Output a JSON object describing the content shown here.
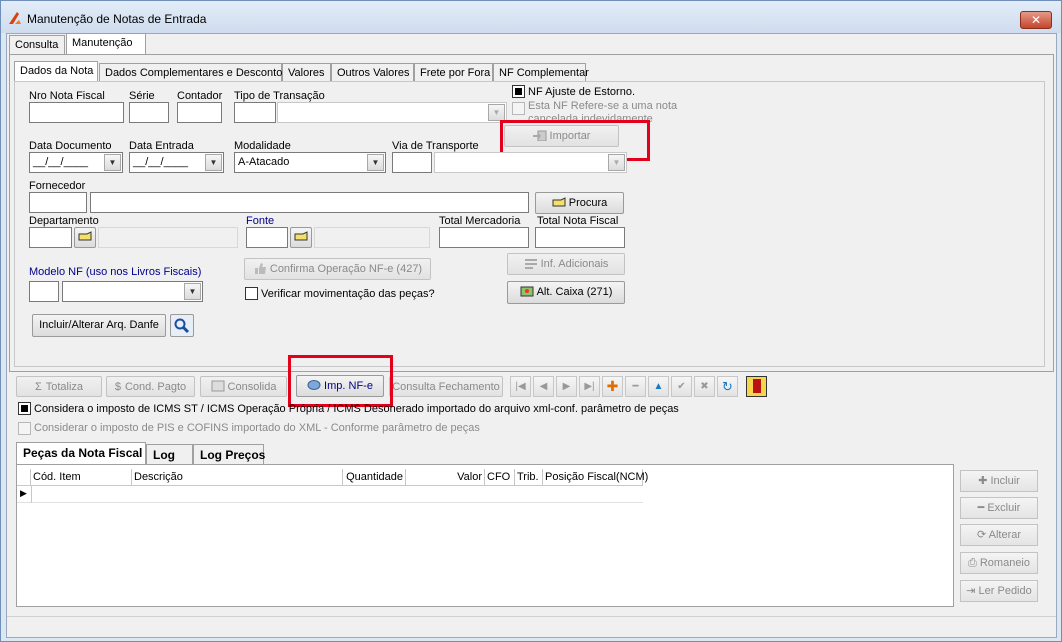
{
  "window": {
    "title": "Manutenção de Notas de Entrada",
    "close_label": "✕"
  },
  "main_tabs": [
    "Consulta",
    "Manutenção"
  ],
  "sub_tabs": [
    "Dados da Nota",
    "Dados Complementares e Desconto",
    "Valores",
    "Outros Valores",
    "Frete por Fora",
    "NF Complementar"
  ],
  "form": {
    "nro_nota_label": "Nro Nota Fiscal",
    "serie_label": "Série",
    "contador_label": "Contador",
    "tipo_transacao_label": "Tipo de Transação",
    "nf_ajuste_label": "NF Ajuste  de Estorno.",
    "nf_refere_label": "Esta NF Refere-se a uma nota cancelada indevidamente",
    "importar_label": "Importar",
    "data_documento_label": "Data Documento",
    "data_documento_value": "__/__/____",
    "data_entrada_label": "Data Entrada",
    "data_entrada_value": "__/__/____",
    "modalidade_label": "Modalidade",
    "modalidade_value": "A-Atacado",
    "via_transporte_label": "Via de Transporte",
    "fornecedor_label": "Fornecedor",
    "procura_label": "Procura",
    "departamento_label": "Departamento",
    "fonte_label": "Fonte",
    "total_mercadoria_label": "Total Mercadoria",
    "total_nota_label": "Total Nota Fiscal",
    "modelo_nf_label": "Modelo NF (uso nos Livros Fiscais)",
    "confirma_operacao_label": "Confirma Operação NF-e (427)",
    "inf_adicionais_label": "Inf. Adicionais",
    "verificar_label": "Verificar movimentação das peças?",
    "alt_caixa_label": "Alt. Caixa (271)",
    "incluir_danfe_label": "Incluir/Alterar Arq. Danfe"
  },
  "toolbar": {
    "totaliza": "Totaliza",
    "cond_pagto": "Cond. Pagto",
    "consolida": "Consolida",
    "imp_nfe": "Imp. NF-e",
    "consulta_fechamento": "Consulta Fechamento"
  },
  "options": {
    "icms_label": "Considera o imposto de ICMS ST / ICMS Operação Própria / ICMS Desonerado importado do arquivo xml-conf. parâmetro de peças",
    "pis_label": "Considerar o imposto de PIS e COFINS importado do XML - Conforme parâmetro de peças"
  },
  "bottom_tabs": [
    "Peças da Nota Fiscal",
    "Log",
    "Log Preços"
  ],
  "grid": {
    "columns": [
      "Cód. Item",
      "Descrição",
      "Quantidade",
      "Valor",
      "CFO",
      "Trib.",
      "Posição Fiscal(NCM)"
    ]
  },
  "side_buttons": [
    "Incluir",
    "Excluir",
    "Alterar",
    "Romaneio",
    "Ler Pedido"
  ],
  "colors": {
    "highlight": "#e3001b",
    "link_blue": "#00008b"
  }
}
